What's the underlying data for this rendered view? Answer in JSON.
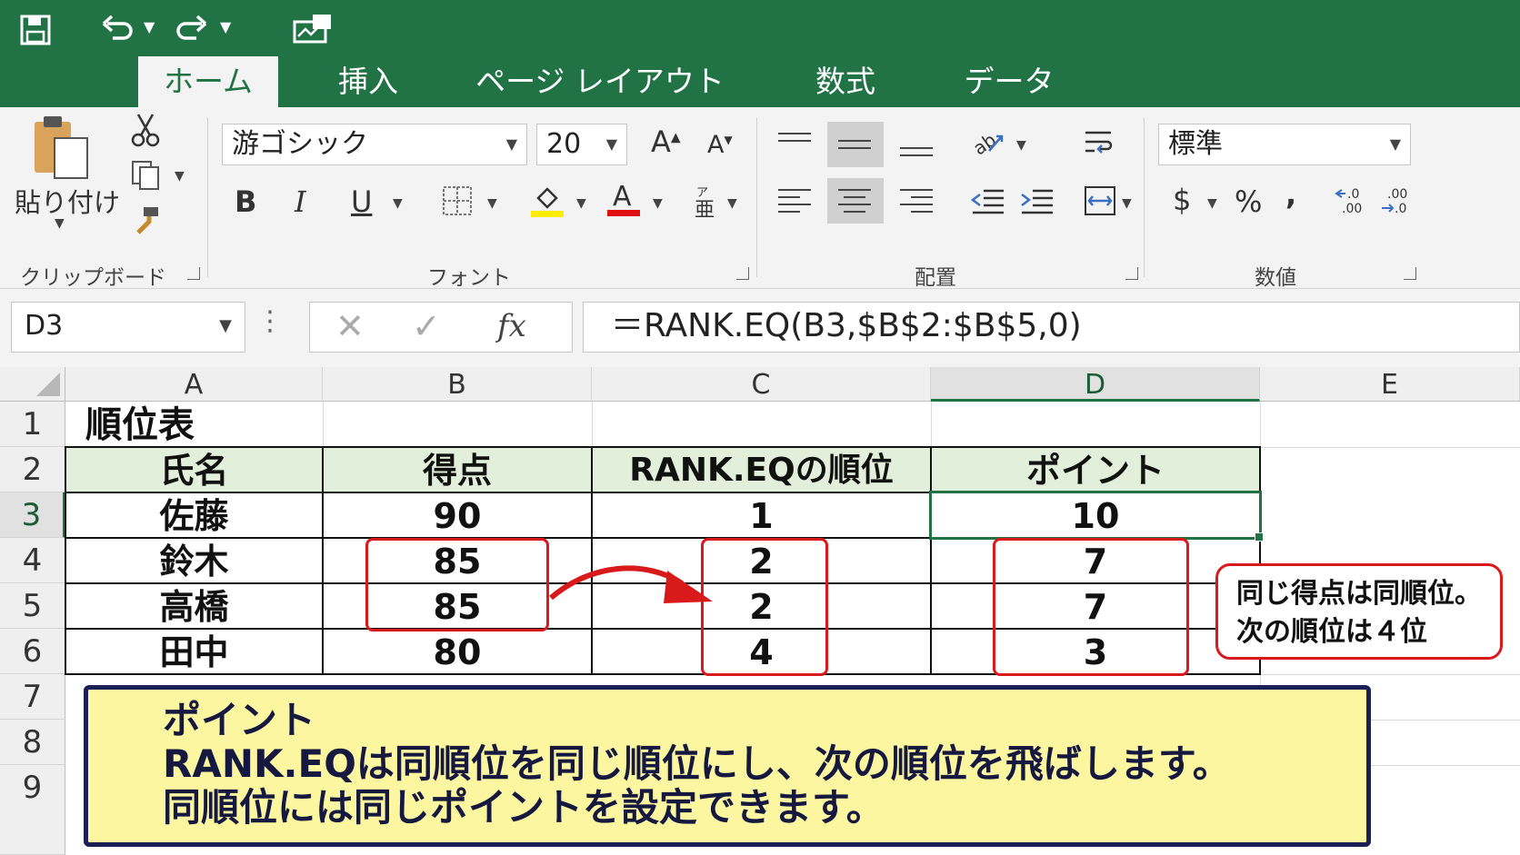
{
  "tabs": [
    "ホーム",
    "挿入",
    "ページ レイアウト",
    "数式",
    "データ"
  ],
  "clipboard": {
    "paste_label": "貼り付け",
    "group_label": "クリップボード"
  },
  "font": {
    "family": "游ゴシック",
    "size": "20",
    "group_label": "フォント"
  },
  "alignment": {
    "group_label": "配置"
  },
  "number": {
    "format": "標準",
    "group_label": "数値",
    "currency": "$",
    "percent": "%",
    "comma": ","
  },
  "formula_bar": {
    "name_box": "D3",
    "formula": "＝RANK.EQ(B3,$B$2:$B$5,0)",
    "fx": "fx"
  },
  "columns": [
    "A",
    "B",
    "C",
    "D",
    "E"
  ],
  "rows": [
    "1",
    "2",
    "3",
    "4",
    "5",
    "6",
    "7",
    "8",
    "9"
  ],
  "sheet": {
    "title": "順位表",
    "headers": [
      "氏名",
      "得点",
      "RANK.EQの順位",
      "ポイント"
    ],
    "data": [
      [
        "佐藤",
        "90",
        "1",
        "10"
      ],
      [
        "鈴木",
        "85",
        "2",
        "7"
      ],
      [
        "高橋",
        "85",
        "2",
        "7"
      ],
      [
        "田中",
        "80",
        "4",
        "3"
      ]
    ]
  },
  "callout": {
    "line1": "同じ得点は同順位。",
    "line2": "次の順位は４位"
  },
  "note": {
    "title": "ポイント",
    "line1": "RANK.EQは同順位を同じ順位にし、次の順位を飛ばします。",
    "line2": "同順位には同じポイントを設定できます。"
  },
  "colors": {
    "excel_green": "#217346",
    "header_fill": "#e2efda",
    "red": "#d91a1a",
    "note_bg": "#fdf6a0",
    "note_border": "#1a1f55"
  }
}
